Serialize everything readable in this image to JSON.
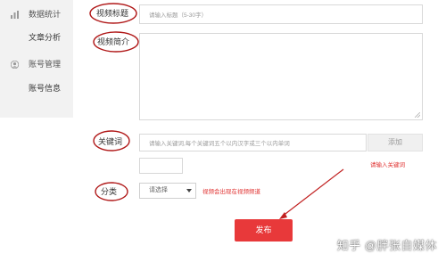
{
  "sidebar": {
    "items": [
      {
        "label": "数据统计",
        "icon": "bar-chart-icon"
      },
      {
        "label": "文章分析"
      },
      {
        "label": "账号管理",
        "icon": "user-icon"
      },
      {
        "label": "账号信息"
      }
    ]
  },
  "form": {
    "title": {
      "label": "视频标题",
      "placeholder": "请输入标题（5-30字）"
    },
    "intro": {
      "label": "视频简介"
    },
    "keywords": {
      "label": "关键词",
      "placeholder": "请输入关键词,每个关键词五个以内汉字或三个以内单词",
      "add_button": "添加",
      "note": "请输入关键词"
    },
    "category": {
      "label": "分类",
      "selected": "请选择",
      "note": "视频会出现在视频频道"
    },
    "publish_button": "发布"
  },
  "watermark": "知乎 @胖张自媒体",
  "colors": {
    "accent": "#e8393a",
    "annotation": "#b01818"
  }
}
